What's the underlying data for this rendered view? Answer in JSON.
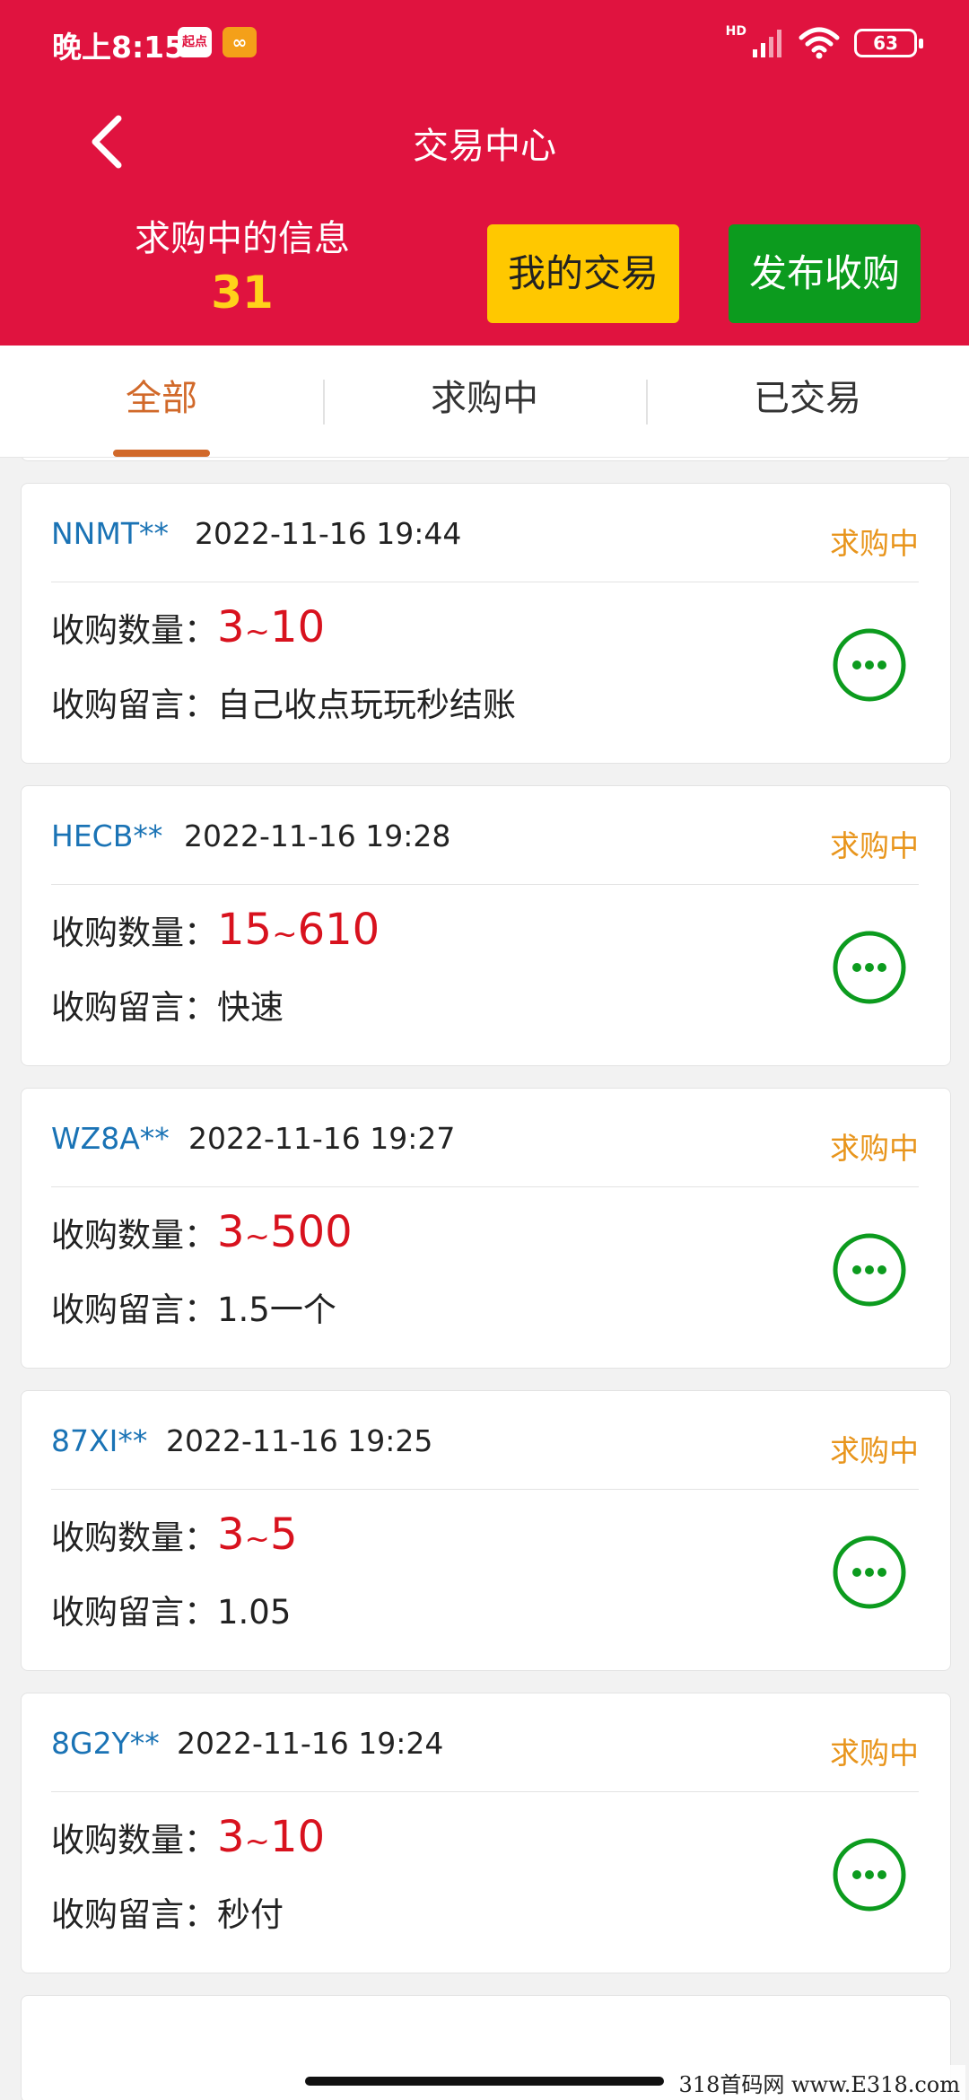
{
  "status_bar": {
    "time": "晚上8:15",
    "badge_1": "起点",
    "hd": "HD",
    "battery": "63"
  },
  "nav": {
    "title": "交易中心"
  },
  "summary": {
    "label": "求购中的信息",
    "count": "31"
  },
  "buttons": {
    "my_trades": "我的交易",
    "publish": "发布收购"
  },
  "tabs": [
    {
      "label": "全部",
      "active": true
    },
    {
      "label": "求购中",
      "active": false
    },
    {
      "label": "已交易",
      "active": false
    }
  ],
  "labels": {
    "qty": "收购数量：",
    "msg": "收购留言："
  },
  "partial_card": {
    "msg": "秒付"
  },
  "orders": [
    {
      "user": "NNMT**",
      "date": "2022-11-16 19:44",
      "status": "求购中",
      "qty_min": "3",
      "qty_max": "10",
      "msg": "自己收点玩玩秒结账"
    },
    {
      "user": "HECB**",
      "date": "2022-11-16 19:28",
      "status": "求购中",
      "qty_min": "15",
      "qty_max": "610",
      "msg": "快速"
    },
    {
      "user": "WZ8A**",
      "date": "2022-11-16 19:27",
      "status": "求购中",
      "qty_min": "3",
      "qty_max": "500",
      "msg": "1.5一个"
    },
    {
      "user": "87XI**",
      "date": "2022-11-16 19:25",
      "status": "求购中",
      "qty_min": "3",
      "qty_max": "5",
      "msg": "1.05"
    },
    {
      "user": "8G2Y**",
      "date": "2022-11-16 19:24",
      "status": "求购中",
      "qty_min": "3",
      "qty_max": "10",
      "msg": "秒付"
    }
  ],
  "tilde": "~",
  "watermark": "318首码网 www.E318.com",
  "colors": {
    "header_red": "#e0133f",
    "count_yellow": "#ffd21a",
    "my_trades_bg": "#ffc800",
    "publish_bg": "#0c9b1e",
    "tab_active": "#d1692a",
    "user_blue": "#1a73b5",
    "status_orange": "#e8951c",
    "qty_red": "#d8121e",
    "more_green": "#0c9b1e"
  },
  "icons": [
    "back-arrow-icon",
    "wifi-icon",
    "signal-icon",
    "battery-icon",
    "more-dots-icon"
  ]
}
